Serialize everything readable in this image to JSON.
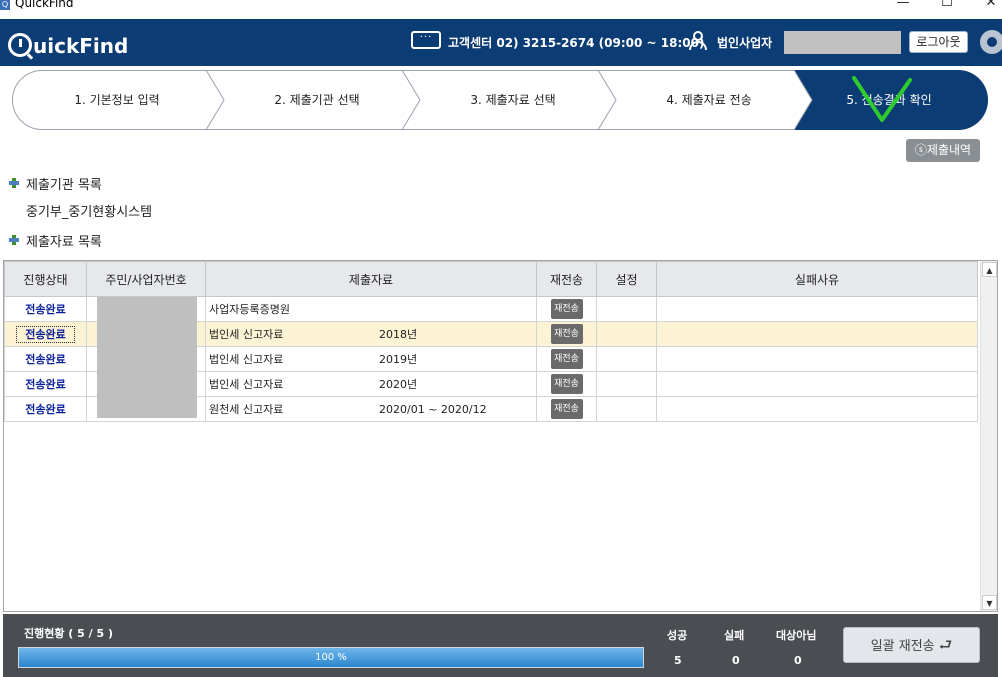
{
  "window": {
    "title": "QuickFind",
    "minimize": "—",
    "maximize": "☐",
    "close": "✕"
  },
  "header": {
    "logo": "uickFind",
    "support_text": "고객센터 02) 3215-2674 (09:00 ~ 18:00)",
    "user_label": "법인사업자",
    "logout_label": "로그아웃"
  },
  "steps": [
    {
      "label": "1. 기본정보 입력",
      "active": false
    },
    {
      "label": "2. 제출기관 선택",
      "active": false
    },
    {
      "label": "3. 제출자료 선택",
      "active": false
    },
    {
      "label": "4. 제출자료 전송",
      "active": false
    },
    {
      "label": "5. 전송결과 확인",
      "active": true
    }
  ],
  "history_button": "ⓢ제출내역",
  "org_section": {
    "title": "제출기관 목록",
    "org_name": "중기부_중기현황시스템"
  },
  "data_section": {
    "title": "제출자료 목록"
  },
  "table": {
    "columns": [
      "진행상태",
      "주민/사업자번호",
      "제출자료",
      "재전송",
      "설정",
      "실패사유"
    ],
    "resend_label": "재전송",
    "rows": [
      {
        "status": "전송완료",
        "item": "사업자등록증명원",
        "period": ""
      },
      {
        "status": "전송완료",
        "item": "법인세 신고자료",
        "period": "2018년"
      },
      {
        "status": "전송완료",
        "item": "법인세 신고자료",
        "period": "2019년"
      },
      {
        "status": "전송완료",
        "item": "법인세 신고자료",
        "period": "2020년"
      },
      {
        "status": "전송완료",
        "item": "원천세 신고자료",
        "period": "2020/01 ~ 2020/12"
      }
    ],
    "selected_row": 1
  },
  "footer": {
    "progress_label": "진행현황 (  5  / 5   )",
    "progress_percent": 100,
    "progress_text": "100 %",
    "success_label": "성공",
    "success_value": "5",
    "fail_label": "실패",
    "fail_value": "0",
    "na_label": "대상아님",
    "na_value": "0",
    "bulk_resend": "일괄 재전송"
  },
  "colors": {
    "header": "#0c3c74",
    "active_step": "#0c3c74",
    "status_text": "#0a1f9a",
    "checkmark": "#2ecc2e"
  }
}
